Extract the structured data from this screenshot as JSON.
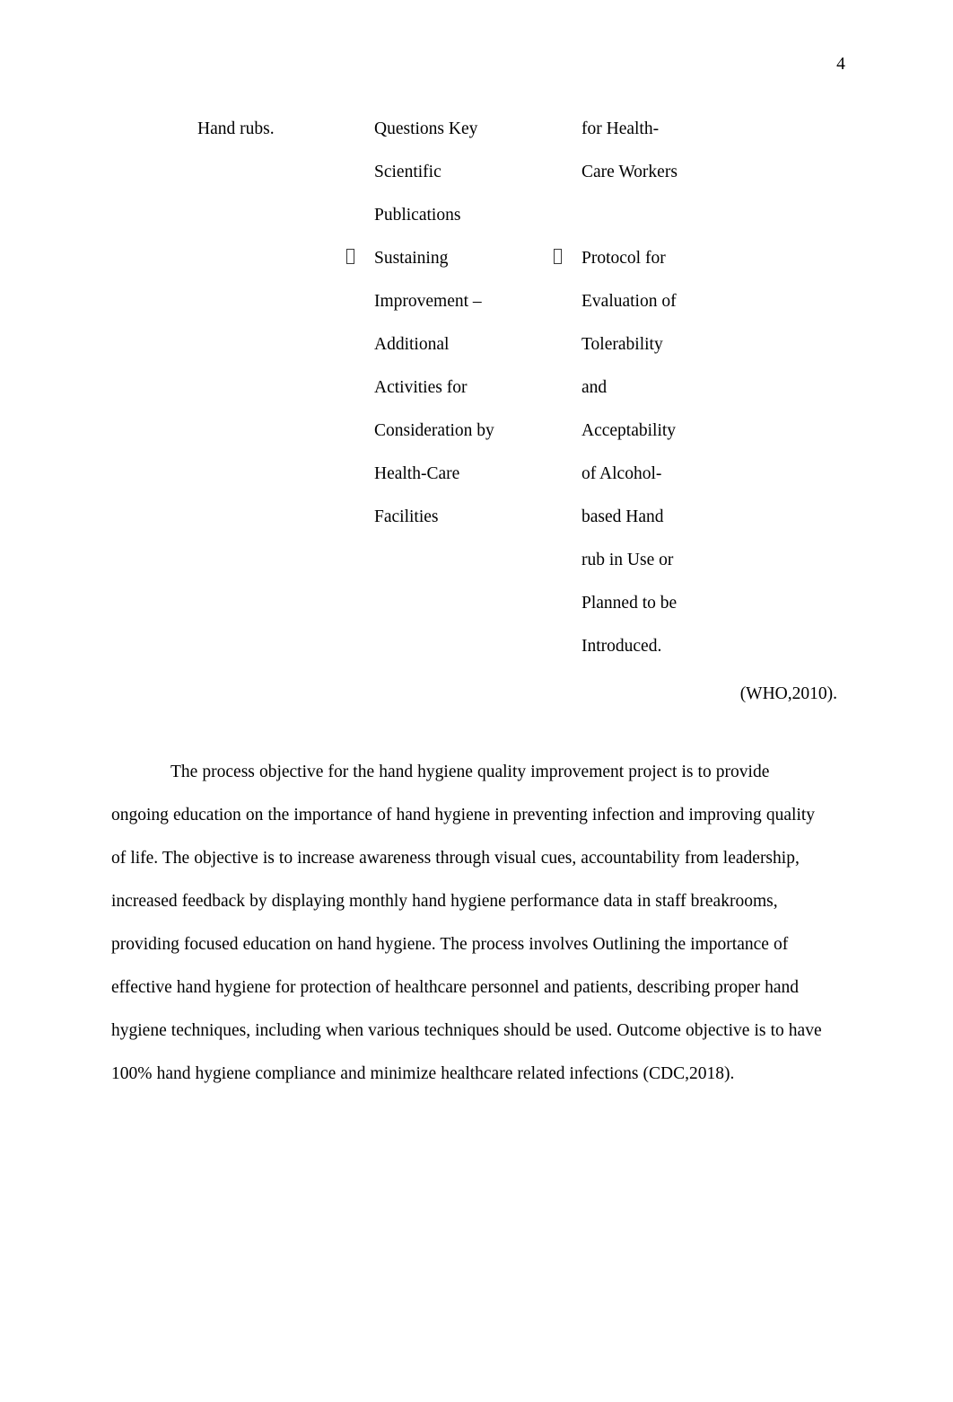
{
  "document": {
    "page_number": "4",
    "citation": "(WHO,2010)."
  },
  "columns": {
    "column_1": {
      "lines": [
        "Hand rubs."
      ]
    },
    "column_2": {
      "lines": [
        {
          "text": "Questions Key",
          "bullet": false
        },
        {
          "text": "Scientific",
          "bullet": false
        },
        {
          "text": "Publications",
          "bullet": false
        },
        {
          "text": "Sustaining",
          "bullet": true
        },
        {
          "text": "Improvement –",
          "bullet": false
        },
        {
          "text": "Additional",
          "bullet": false
        },
        {
          "text": "Activities for",
          "bullet": false
        },
        {
          "text": "Consideration by",
          "bullet": false
        },
        {
          "text": "Health-Care",
          "bullet": false
        },
        {
          "text": "Facilities",
          "bullet": false
        }
      ]
    },
    "column_3": {
      "lines": [
        {
          "text": "for Health-",
          "bullet": false
        },
        {
          "text": "Care Workers",
          "bullet": false
        },
        {
          "text": "",
          "bullet": false
        },
        {
          "text": "Protocol for",
          "bullet": true
        },
        {
          "text": "Evaluation of",
          "bullet": false
        },
        {
          "text": "Tolerability",
          "bullet": false
        },
        {
          "text": "and",
          "bullet": false
        },
        {
          "text": "Acceptability",
          "bullet": false
        },
        {
          "text": "of Alcohol-",
          "bullet": false
        },
        {
          "text": "based Hand",
          "bullet": false
        },
        {
          "text": "rub in Use or",
          "bullet": false
        },
        {
          "text": "Planned to be",
          "bullet": false
        },
        {
          "text": "Introduced.",
          "bullet": false
        }
      ]
    }
  },
  "body": {
    "paragraph": "The process objective for the hand hygiene quality improvement project is to provide ongoing education on the importance of hand hygiene in preventing infection and improving quality of life. The objective is to increase awareness through visual cues, accountability from leadership, increased feedback by displaying monthly hand hygiene performance data in staff breakrooms, providing focused education on hand hygiene. The process involves Outlining the importance of effective hand hygiene for protection of healthcare personnel and patients, describing proper hand hygiene techniques, including when various techniques should be used. Outcome objective is to have 100% hand hygiene compliance and minimize healthcare related infections (CDC,2018)."
  }
}
